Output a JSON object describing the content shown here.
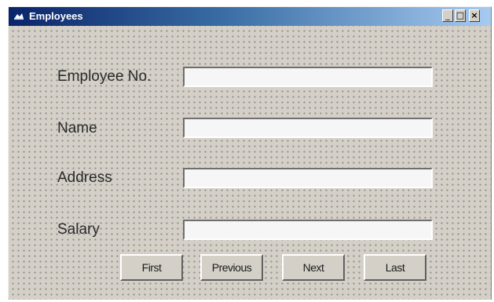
{
  "window": {
    "title": "Employees",
    "minimize_glyph": "_",
    "maximize_glyph": "□",
    "close_glyph": "×"
  },
  "form": {
    "fields": [
      {
        "label": "Employee No.",
        "value": ""
      },
      {
        "label": "Name",
        "value": ""
      },
      {
        "label": "Address",
        "value": ""
      },
      {
        "label": "Salary",
        "value": ""
      }
    ]
  },
  "buttons": {
    "first": "First",
    "previous": "Previous",
    "next": "Next",
    "last": "Last"
  },
  "icons": {
    "title_icon": "form-icon"
  },
  "colors": {
    "titlebar_start": "#0a246a",
    "titlebar_end": "#a6caf0",
    "face": "#d4d0c8"
  }
}
